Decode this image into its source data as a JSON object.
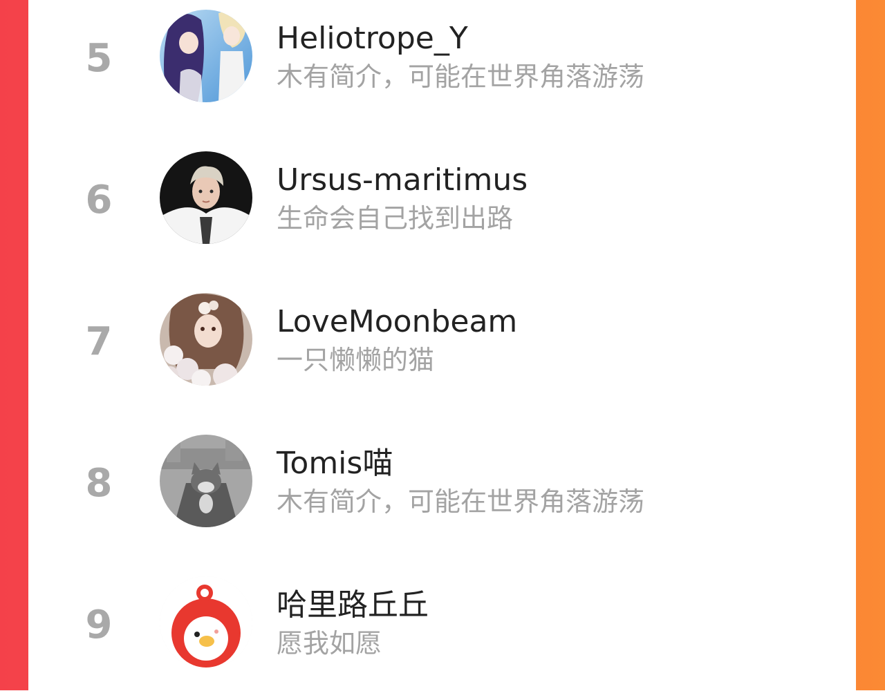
{
  "colors": {
    "background_gradient_start": "#f4414a",
    "background_gradient_end": "#fb8a34",
    "rank_text": "#a9a9a9",
    "name_text": "#222222",
    "bio_text": "#a3a3a3",
    "card": "#ffffff"
  },
  "list": [
    {
      "rank": "5",
      "name": "Heliotrope_Y",
      "bio": "木有简介，可能在世界角落游荡",
      "avatar_icon": "anime-couple-avatar"
    },
    {
      "rank": "6",
      "name": "Ursus-maritimus",
      "bio": "生命会自己找到出路",
      "avatar_icon": "man-portrait-avatar"
    },
    {
      "rank": "7",
      "name": "LoveMoonbeam",
      "bio": "一只懒懒的猫",
      "avatar_icon": "anime-girl-flowers-avatar"
    },
    {
      "rank": "8",
      "name": "Tomis喵",
      "bio": "木有简介，可能在世界角落游荡",
      "avatar_icon": "cartoon-cat-avatar"
    },
    {
      "rank": "9",
      "name": "哈里路丘丘",
      "bio": "愿我如愿",
      "avatar_icon": "red-duck-mascot-avatar"
    }
  ]
}
